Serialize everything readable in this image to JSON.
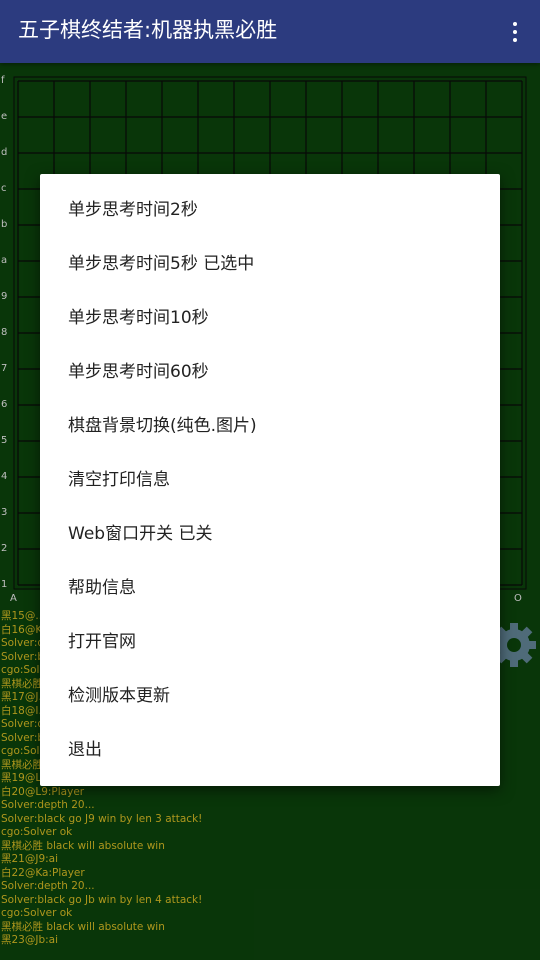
{
  "appbar": {
    "title": "五子棋终结者:机器执黑必胜",
    "menu_icon": "overflow-vertical-icon",
    "color": "#2c3b7f"
  },
  "board": {
    "background": "#0b3e0b",
    "line_color": "#0a0a0a",
    "row_labels": [
      "f",
      "e",
      "d",
      "c",
      "b",
      "a",
      "9",
      "8",
      "7",
      "6",
      "5",
      "4",
      "3",
      "2",
      "1"
    ],
    "col_labels": [
      "A",
      "O"
    ]
  },
  "log": {
    "text_color": "#c6ac22",
    "lines": [
      "黑15@...",
      "白16@K...",
      "Solver:d...",
      "Solver:b...",
      "cgo:Sol...",
      "黑棋必胜...",
      "黑17@J...",
      "白18@I...",
      "Solver:d...",
      "Solver:b...",
      "cgo:Sol...",
      "黑棋必胜...",
      "黑19@L...",
      "白20@L9:Player",
      "Solver:depth 20...",
      "Solver:black go J9 win by len 3 attack!",
      "cgo:Solver ok",
      "黑棋必胜 black will absolute win",
      "黑21@J9:ai",
      "白22@Ka:Player",
      "Solver:depth 20...",
      "Solver:black go Jb win by len 4 attack!",
      "cgo:Solver ok",
      "黑棋必胜 black will absolute win",
      "黑23@Jb:ai"
    ]
  },
  "settings_icon": "gear-icon",
  "menu": {
    "items": [
      {
        "label": "单步思考时间2秒"
      },
      {
        "label": "单步思考时间5秒  已选中"
      },
      {
        "label": "单步思考时间10秒"
      },
      {
        "label": "单步思考时间60秒"
      },
      {
        "label": "棋盘背景切换(纯色.图片)"
      },
      {
        "label": "清空打印信息"
      },
      {
        "label": "Web窗口开关  已关"
      },
      {
        "label": "帮助信息"
      },
      {
        "label": "打开官网"
      },
      {
        "label": "检测版本更新"
      },
      {
        "label": "退出"
      }
    ]
  }
}
